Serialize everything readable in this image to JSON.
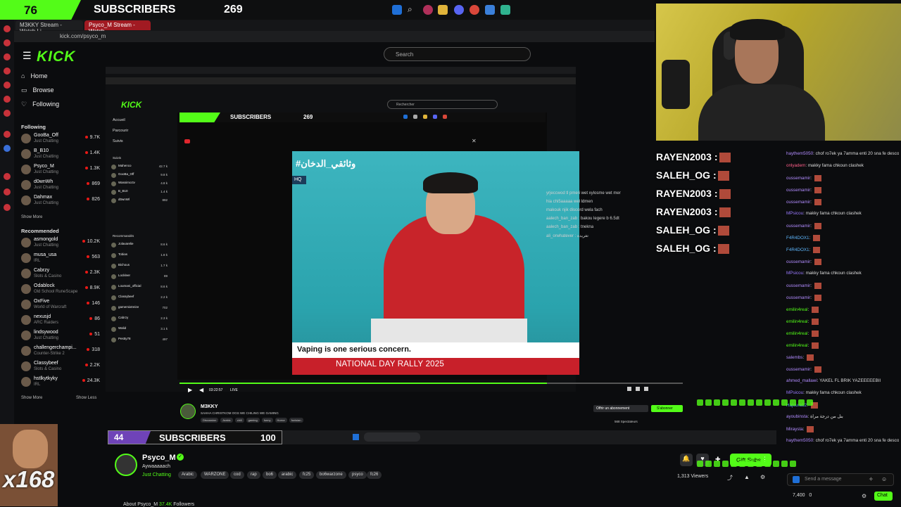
{
  "sub_goal_top": {
    "count": "76",
    "label": "SUBSCRIBERS",
    "target": "269"
  },
  "browser": {
    "tabs": [
      "M3KKY Stream - Watch Li...",
      "Psyco_M Stream - Watch ..."
    ],
    "url": "kick.com/psyco_m"
  },
  "kick": {
    "logo": "KICK",
    "search_placeholder": "Search",
    "nav": [
      {
        "icon": "home-icon",
        "label": "Home"
      },
      {
        "icon": "browse-icon",
        "label": "Browse"
      },
      {
        "icon": "heart-icon",
        "label": "Following"
      }
    ],
    "following_title": "Following",
    "following": [
      {
        "name": "GooBa_Off",
        "category": "Just Chatting",
        "viewers": "9.7K"
      },
      {
        "name": "B_B10",
        "category": "Just Chatting",
        "viewers": "1.4K"
      },
      {
        "name": "Psyco_M",
        "category": "Just Chatting",
        "viewers": "1.3K"
      },
      {
        "name": "d0wnWh",
        "category": "Just Chatting",
        "viewers": "869"
      },
      {
        "name": "Dahmax",
        "category": "Just Chatting",
        "viewers": "826"
      }
    ],
    "show_more": "Show More",
    "recommended_title": "Recommended",
    "recommended": [
      {
        "name": "asmongold",
        "category": "Just Chatting",
        "viewers": "10.2K"
      },
      {
        "name": "musa_usa",
        "category": "IRL",
        "viewers": "563"
      },
      {
        "name": "Cabrzy",
        "category": "Slots & Casino",
        "viewers": "2.3K"
      },
      {
        "name": "Odablock",
        "category": "Old School RuneScape",
        "viewers": "8.9K"
      },
      {
        "name": "OxFive",
        "category": "World of Warcraft",
        "viewers": "146"
      },
      {
        "name": "nexusjd",
        "category": "ARC Raiders",
        "viewers": "86"
      },
      {
        "name": "lindsywood",
        "category": "Just Chatting",
        "viewers": "51"
      },
      {
        "name": "challengerchampi...",
        "category": "Counter-Strike 2",
        "viewers": "318"
      },
      {
        "name": "Classybeef",
        "category": "Slots & Casino",
        "viewers": "2.2K"
      },
      {
        "name": "hstlkytkyky",
        "category": "IRL",
        "viewers": "24.3K"
      }
    ],
    "show_less": "Show Less"
  },
  "inner": {
    "logo": "KICK",
    "search": "Rechercher",
    "nav": [
      "Accueil",
      "Parcourir",
      "Suivis"
    ],
    "suivis_title": "Suivis",
    "suivis": [
      {
        "name": "Mahenco",
        "viewers": "42.7 k"
      },
      {
        "name": "GooBa_Off",
        "viewers": "9.8 k"
      },
      {
        "name": "Wassimcctv",
        "viewers": "4.8 k"
      },
      {
        "name": "B_B10",
        "viewers": "1.4 k"
      },
      {
        "name": "d0wnWl",
        "viewers": "892"
      }
    ],
    "reco_title": "Recommandés",
    "reco": [
      {
        "name": "Jolavarelie",
        "viewers": "8.6 k"
      },
      {
        "name": "Tobias",
        "viewers": "1.8 k"
      },
      {
        "name": "Bichous",
        "viewers": "1.7 k"
      },
      {
        "name": "Lockleer",
        "viewers": "89"
      },
      {
        "name": "Loumani_official",
        "viewers": "8.6 k"
      },
      {
        "name": "Classybeef",
        "viewers": "2.2 k"
      },
      {
        "name": "gamemixtreize",
        "viewers": "702"
      },
      {
        "name": "Cabrzy",
        "viewers": "2.3 k"
      },
      {
        "name": "Walid",
        "viewers": "3.1 k"
      },
      {
        "name": "Pestty78",
        "viewers": "497"
      }
    ],
    "sub_goal": {
      "label": "SUBSCRIBERS",
      "target": "269"
    },
    "streamer": "M3KKY",
    "streamer_title": "SAHHA CHRISTKOM OGS WE CHILING WE GAMING",
    "tags": [
      "Discussion",
      "Arabic",
      "chill",
      "gaming",
      "funny",
      "Horror",
      "funisian"
    ],
    "subscribe": "S'abonner",
    "gift": "Offrir un abonnement",
    "viewers": "568 Spectateurs",
    "time": "03:22:57",
    "live": "LIVE"
  },
  "video": {
    "hashtag": "#وثائقي_الدخان",
    "hq": "HQ",
    "caption": "Vaping is one serious concern.",
    "banner": "NATIONAL DAY RALLY 2025"
  },
  "overlay_chat": [
    {
      "name": "RAYEN2003",
      "text": ":"
    },
    {
      "name": "SALEH_OG",
      "text": ":"
    },
    {
      "name": "RAYEN2003",
      "text": ":"
    },
    {
      "name": "RAYEN2003",
      "text": ":"
    },
    {
      "name": "SALEH_OG",
      "text": ":"
    },
    {
      "name": "SALEH_OG",
      "text": ":"
    }
  ],
  "inner_chat": [
    "yrjeccwod tl pmeri wet xylosme wet mer",
    "hia chi5aaaaa wel ldmen",
    "makouk njik discord wela fach",
    "aalech_ban_zab : bakou legere b 6.5dt",
    "aalech_ban_zab : tnekna",
    "ali_orwhatever : تغريدة"
  ],
  "chat": [
    {
      "user": "haythem5050",
      "text": "chof ro7ek ya 7amma enti 20 sna fe descord mta3ek ji chat",
      "color": "#b28cff"
    },
    {
      "user": "onlyadem",
      "text": "makky fama chkoun clashek",
      "color": "#ff5f8a"
    },
    {
      "user": "oussemamir",
      "text": "",
      "color": "#b28cff"
    },
    {
      "user": "oussemamir",
      "text": "",
      "color": "#b28cff"
    },
    {
      "user": "oussemamir",
      "text": "",
      "color": "#b28cff"
    },
    {
      "user": "MPsicou",
      "text": "makky fama chkoun clashek",
      "color": "#9b7bff"
    },
    {
      "user": "oussemamir",
      "text": "",
      "color": "#b28cff"
    },
    {
      "user": "F4R4DOX1",
      "text": "",
      "color": "#5fb8ff"
    },
    {
      "user": "F4R4DOX1",
      "text": "",
      "color": "#5fb8ff"
    },
    {
      "user": "oussemamir",
      "text": "",
      "color": "#b28cff"
    },
    {
      "user": "MPsicou",
      "text": "makky fama chkoun clashek",
      "color": "#9b7bff"
    },
    {
      "user": "oussemamir",
      "text": "",
      "color": "#b28cff"
    },
    {
      "user": "oussemamir",
      "text": "",
      "color": "#b28cff"
    },
    {
      "user": "emilin4real",
      "text": "",
      "color": "#53fc18"
    },
    {
      "user": "emilin4real",
      "text": "",
      "color": "#53fc18"
    },
    {
      "user": "emilin4real",
      "text": "",
      "color": "#53fc18"
    },
    {
      "user": "emilin4real",
      "text": "",
      "color": "#53fc18"
    },
    {
      "user": "salembs",
      "text": "",
      "color": "#b28cff"
    },
    {
      "user": "oussemamir",
      "text": "",
      "color": "#b28cff"
    },
    {
      "user": "ahmed_mallawi",
      "text": "YAKEL FL BRIK YAZEEEEEBII",
      "color": "#b28cff"
    },
    {
      "user": "MPsicou",
      "text": "makky fama chkoun clashek",
      "color": "#9b7bff"
    },
    {
      "user": "Hajoura12",
      "text": "",
      "color": "#5fb8ff"
    },
    {
      "user": "ayoubinsta",
      "text": "بنل من درجة مراة",
      "color": "#b28cff"
    },
    {
      "user": "Miraysta",
      "text": "",
      "color": "#b28cff"
    },
    {
      "user": "haythem5050",
      "text": "chof ro7ek ya 7amma enti 20 sna fe descord mta3ek ji chat",
      "color": "#b28cff"
    }
  ],
  "chat_input_placeholder": "Send a message",
  "chat_button": "Chat",
  "points": "7,400",
  "points_2": "0",
  "bottom_sub": {
    "count": "44",
    "label": "SUBSCRIBERS",
    "target": "100"
  },
  "gift_count": "x168",
  "stream": {
    "name": "Psyco_M",
    "title": "Aywaaaaach",
    "category": "Just Chatting",
    "tags": [
      "Arabic",
      "WARZONE",
      "cod",
      "rap",
      "bo6",
      "arabic",
      "fc25",
      "bo6warzone",
      "psyco",
      "fc26"
    ],
    "gift_subs": "Gift Subs",
    "viewers": "1,313",
    "viewers_label": "Viewers",
    "about": "About Psyco_M",
    "followers": "37.4K",
    "followers_label": "Followers"
  },
  "colors": {
    "accent": "#53fc18",
    "bg": "#0b0c0e",
    "sub_purple": "#6f43b8"
  }
}
